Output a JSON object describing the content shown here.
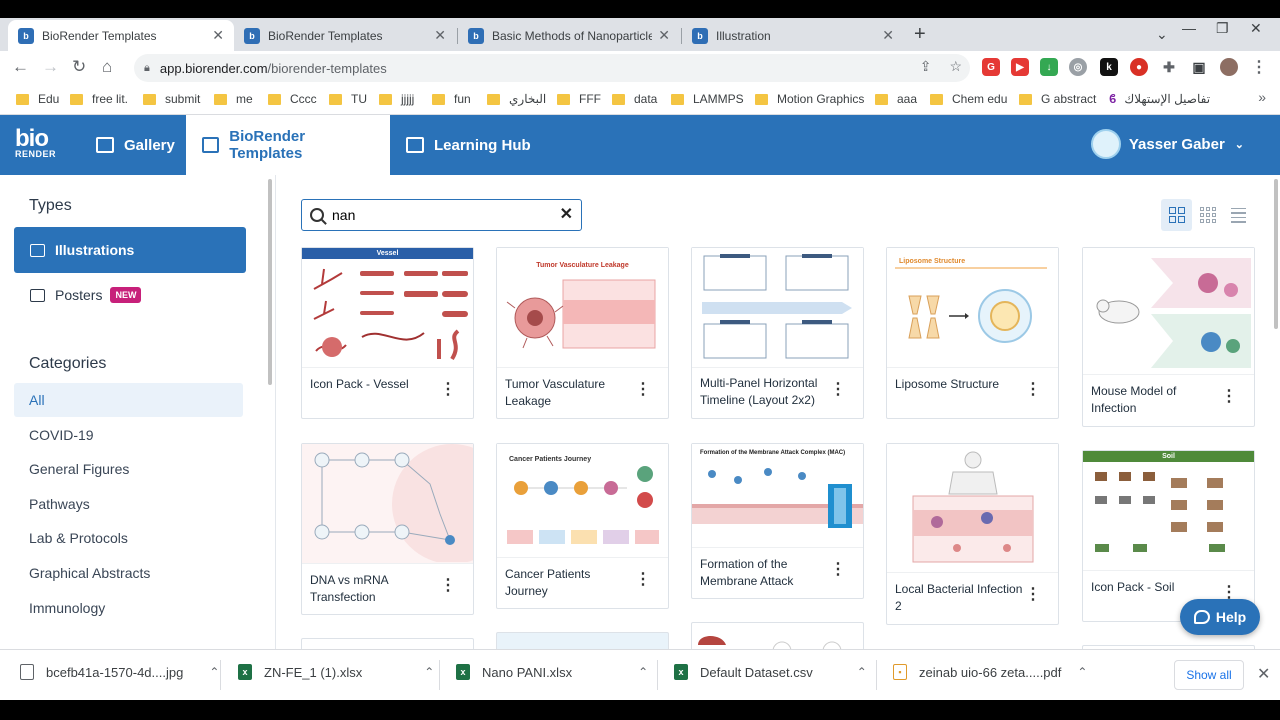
{
  "browser": {
    "tabs": [
      {
        "label": "BioRender Templates",
        "favicon": "bio"
      },
      {
        "label": "BioRender Templates",
        "favicon": "bio"
      },
      {
        "label": "Basic Methods of Nanoparticle S",
        "favicon": "bio"
      },
      {
        "label": "Illustration",
        "favicon": "bio"
      }
    ],
    "url_host": "app.biorender.com",
    "url_path": "/biorender-templates",
    "bookmarks": [
      "Edu",
      "free lit.",
      "submit",
      "me",
      "Cccc",
      "TU",
      "jjjjj",
      "fun",
      "البخاري",
      "FFF",
      "data",
      "LAMMPS",
      "Motion Graphics",
      "aaa",
      "Chem edu",
      "G abstract",
      "تفاصيل الإستهلاك"
    ]
  },
  "app": {
    "logo_top": "bio",
    "logo_bottom": "RENDER",
    "nav": [
      "Gallery",
      "BioRender Templates",
      "Learning Hub"
    ],
    "user_name": "Yasser Gaber",
    "accent": "#2a72b8"
  },
  "sidebar": {
    "types_heading": "Types",
    "types": [
      {
        "label": "Illustrations"
      },
      {
        "label": "Posters",
        "badge": "NEW"
      }
    ],
    "categories_heading": "Categories",
    "categories": [
      "All",
      "COVID-19",
      "General Figures",
      "Pathways",
      "Lab & Protocols",
      "Graphical Abstracts",
      "Immunology"
    ]
  },
  "search": {
    "value": "nan"
  },
  "cards": [
    {
      "title": "Icon Pack - Vessel",
      "thumb_heading": "Vessel"
    },
    {
      "title": "Tumor Vasculature Leakage",
      "thumb_heading": "Tumor Vasculature Leakage"
    },
    {
      "title": "Multi-Panel Horizontal Timeline (Layout 2x2)",
      "thumb_heading": ""
    },
    {
      "title": "Liposome Structure",
      "thumb_heading": "Liposome Structure"
    },
    {
      "title": "Mouse Model of Infection",
      "thumb_heading": ""
    },
    {
      "title": "DNA vs mRNA Transfection",
      "thumb_heading": ""
    },
    {
      "title": "Cancer Patients Journey",
      "thumb_heading": "Cancer Patients Journey"
    },
    {
      "title": "Formation of the Membrane Attack",
      "thumb_heading": "Formation of the Membrane Attack Complex (MAC)"
    },
    {
      "title": "Local Bacterial Infection 2",
      "thumb_heading": ""
    },
    {
      "title": "Icon Pack - Soil",
      "thumb_heading": "Soil"
    }
  ],
  "help_label": "Help",
  "downloads": {
    "items": [
      {
        "name": "bcefb41a-1570-4d....jpg",
        "type": "image"
      },
      {
        "name": "ZN-FE_1 (1).xlsx",
        "type": "excel"
      },
      {
        "name": "Nano PANI.xlsx",
        "type": "excel"
      },
      {
        "name": "Default Dataset.csv",
        "type": "excel"
      },
      {
        "name": "zeinab uio-66 zeta.....pdf",
        "type": "pdf"
      }
    ],
    "show_all": "Show all"
  }
}
